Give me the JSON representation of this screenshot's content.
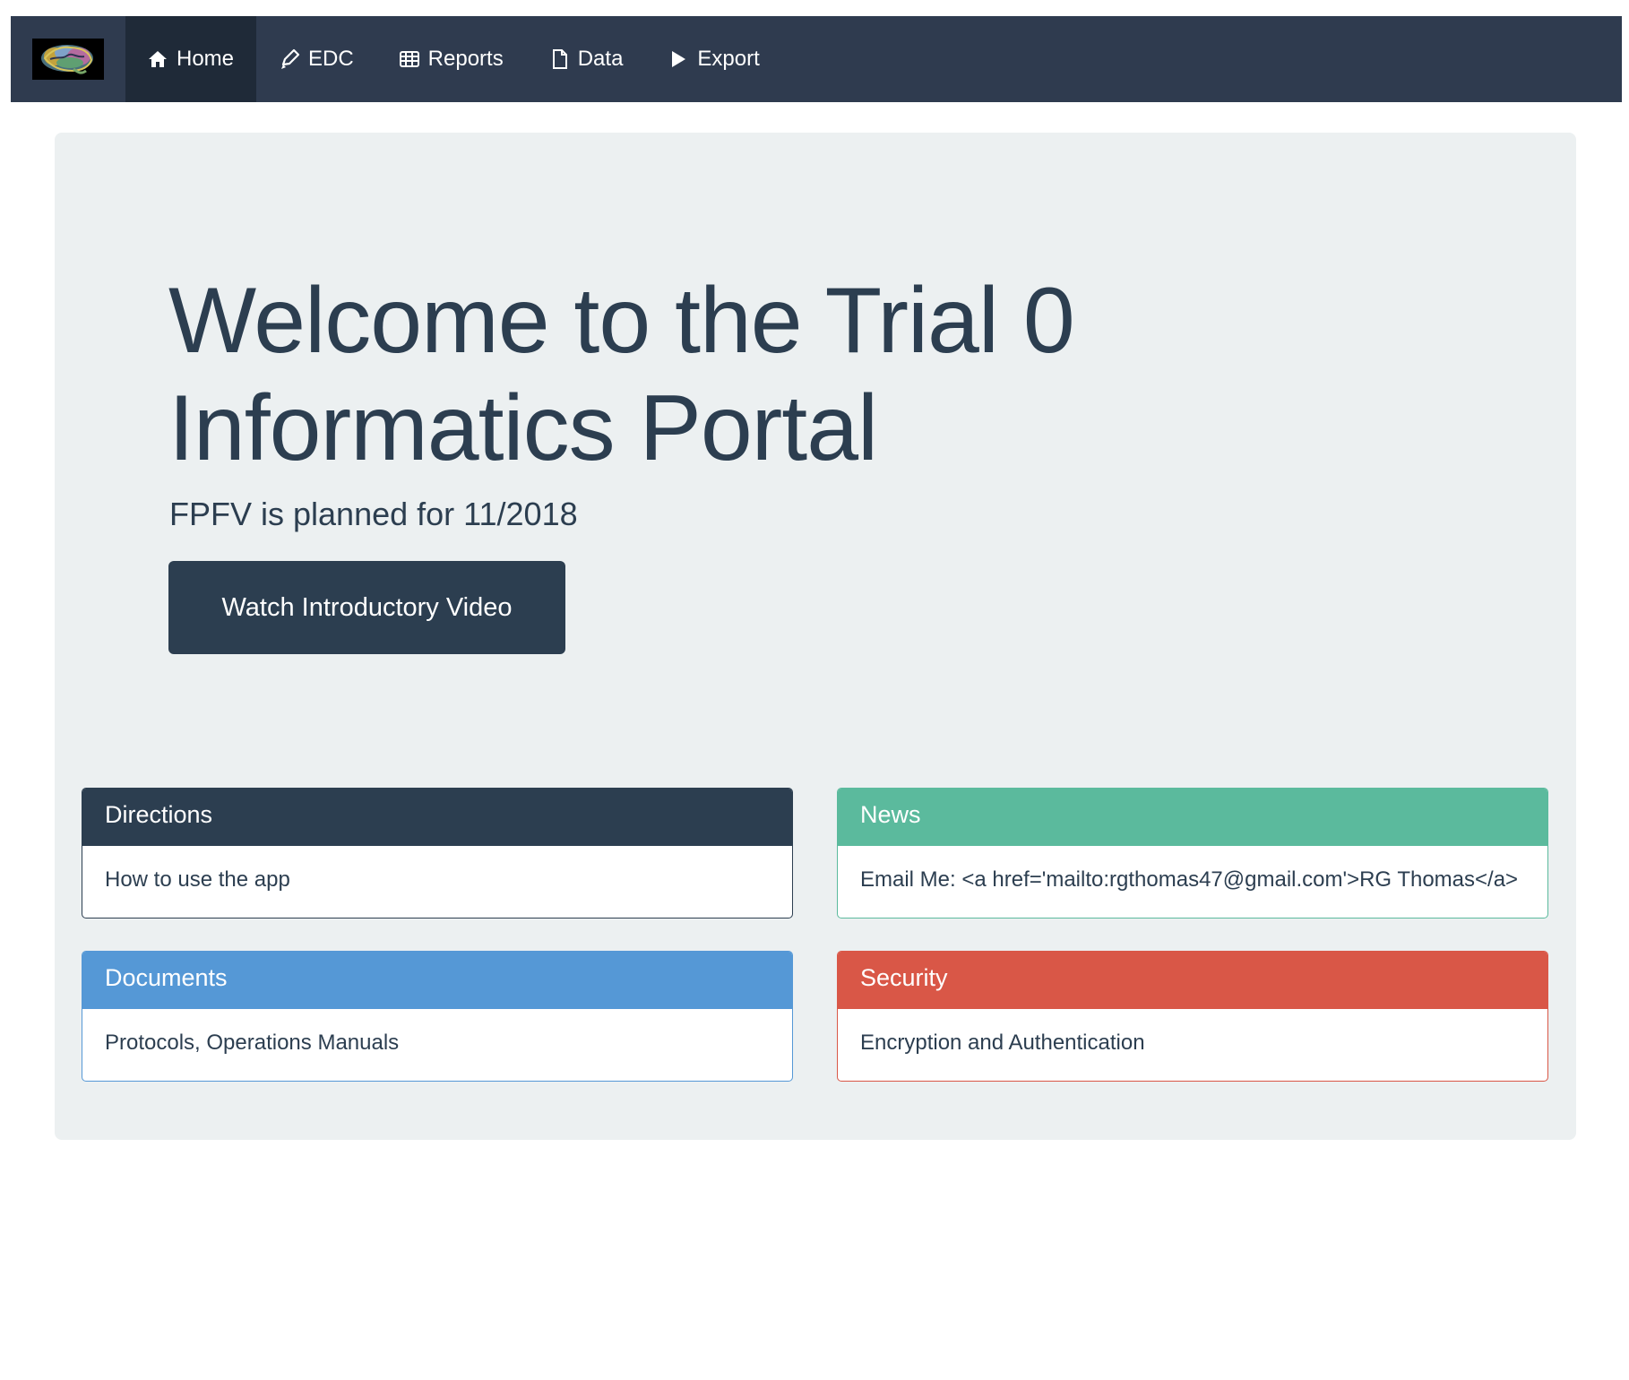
{
  "colors": {
    "nav_bg": "#2f3b4f",
    "nav_active_bg": "#1f2a38",
    "jumbotron_bg": "#ecf0f1",
    "primary": "#2c3e50",
    "success": "#5bba9d",
    "info": "#5598d6",
    "danger": "#d95747"
  },
  "nav": {
    "brand_icon": "brain-logo",
    "items": [
      {
        "label": "Home",
        "icon": "home-icon",
        "active": true
      },
      {
        "label": "EDC",
        "icon": "pencil-icon",
        "active": false
      },
      {
        "label": "Reports",
        "icon": "table-icon",
        "active": false
      },
      {
        "label": "Data",
        "icon": "file-icon",
        "active": false
      },
      {
        "label": "Export",
        "icon": "play-icon",
        "active": false
      }
    ]
  },
  "hero": {
    "title": "Welcome to the Trial 0 Informatics Portal",
    "subtitle": "FPFV is planned for 11/2018",
    "button_label": "Watch Introductory Video"
  },
  "panels": [
    {
      "heading": "Directions",
      "body": "How to use the app"
    },
    {
      "heading": "News",
      "body": "Email Me: <a href='mailto:rgthomas47@gmail.com'>RG Thomas</a>"
    },
    {
      "heading": "Documents",
      "body": "Protocols, Operations Manuals"
    },
    {
      "heading": "Security",
      "body": "Encryption and Authentication"
    }
  ]
}
